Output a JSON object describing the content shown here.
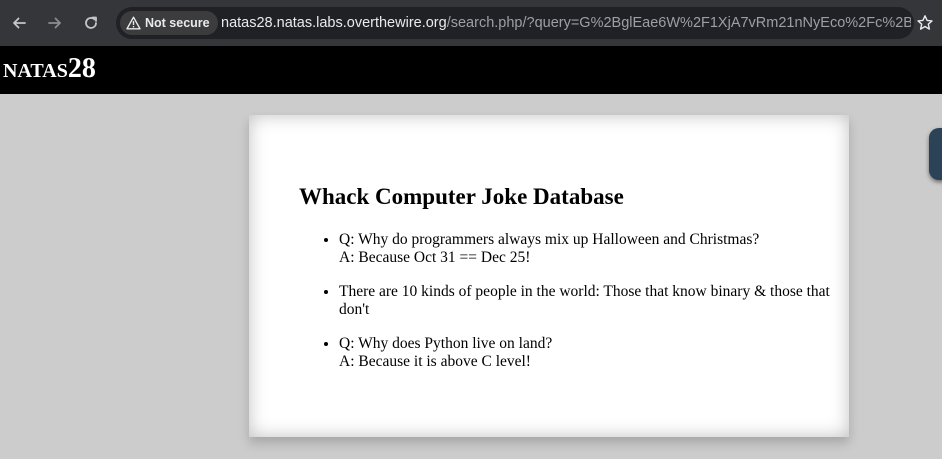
{
  "browser": {
    "security_label": "Not secure",
    "url_domain": "natas28.natas.labs.overthewire.org",
    "url_path": "/search.php/?query=G%2BglEae6W%2F1XjA7vRm21nNyEco%2Fc%2BJ2Td...",
    "icons": {
      "back": "arrow-left-icon",
      "forward": "arrow-right-icon",
      "reload": "reload-icon",
      "warning": "warning-triangle-icon",
      "bookmark": "star-icon"
    }
  },
  "header": {
    "title_prefix": "NATAS",
    "title_number": "28"
  },
  "main": {
    "heading": "Whack Computer Joke Database",
    "jokes": [
      {
        "line1": "Q: Why do programmers always mix up Halloween and Christmas?",
        "line2": "A: Because Oct 31 == Dec 25!"
      },
      {
        "line1": "There are 10 kinds of people in the world: Those that know binary & those that don't",
        "line2": ""
      },
      {
        "line1": "Q: Why does Python live on land?",
        "line2": "A: Because it is above C level!"
      }
    ]
  },
  "colors": {
    "page_background": "#cccccc",
    "header_background": "#000000",
    "browser_chrome": "#35363a",
    "omnibox": "#202124"
  }
}
